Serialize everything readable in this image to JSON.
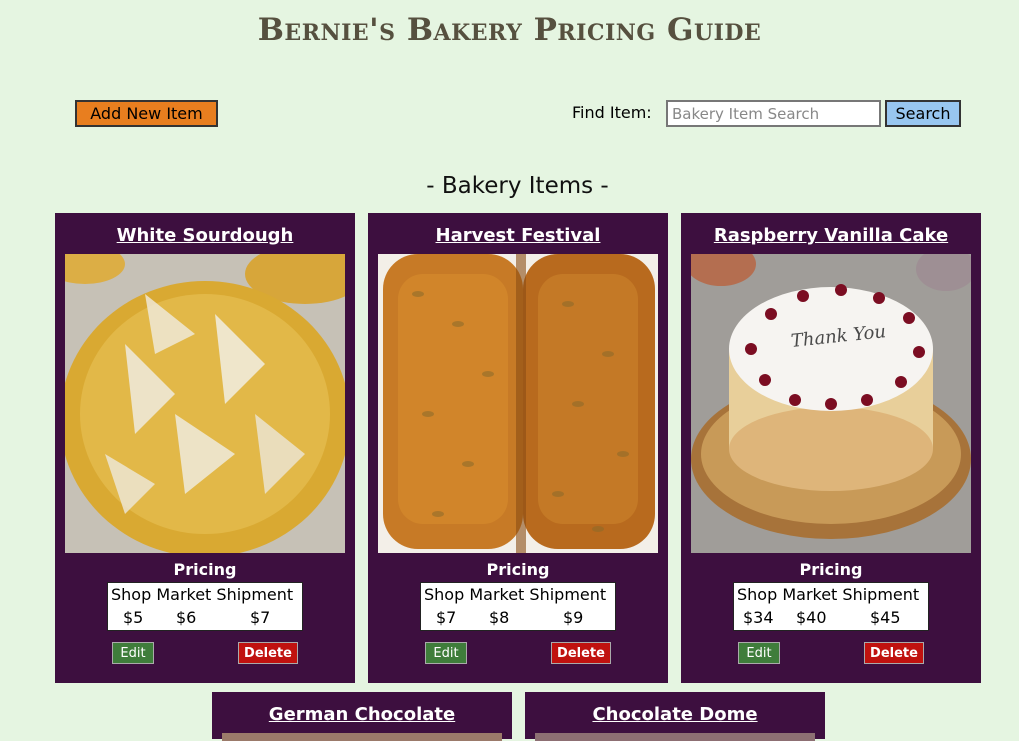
{
  "header": {
    "title": "Bernie's Bakery Pricing Guide"
  },
  "toolbar": {
    "add_label": "Add New Item",
    "find_label": "Find Item:",
    "search_placeholder": "Bakery Item Search",
    "search_value": "",
    "search_label": "Search"
  },
  "section": {
    "heading": "- Bakery Items -"
  },
  "colors": {
    "background": "#e5f5e1",
    "card": "#3d0f3f",
    "add_button": "#e87e1f",
    "search_button": "#98c6f0",
    "edit_button": "#3f7d3b",
    "delete_button": "#c0120f"
  },
  "cards": [
    {
      "name": "White Sourdough",
      "pricing_label": "Pricing",
      "headers": "Shop Market Shipment",
      "shop": "$5",
      "market": "$6",
      "shipment": "$7",
      "edit_label": "Edit",
      "delete_label": "Delete"
    },
    {
      "name": "Harvest Festival",
      "pricing_label": "Pricing",
      "headers": "Shop Market Shipment",
      "shop": "$7",
      "market": "$8",
      "shipment": "$9",
      "edit_label": "Edit",
      "delete_label": "Delete"
    },
    {
      "name": "Raspberry Vanilla Cake",
      "pricing_label": "Pricing",
      "headers": "Shop Market Shipment",
      "shop": "$34",
      "market": "$40",
      "shipment": "$45",
      "edit_label": "Edit",
      "delete_label": "Delete",
      "image_text": "Thank You"
    },
    {
      "name": "German Chocolate"
    },
    {
      "name": "Chocolate Dome"
    }
  ]
}
